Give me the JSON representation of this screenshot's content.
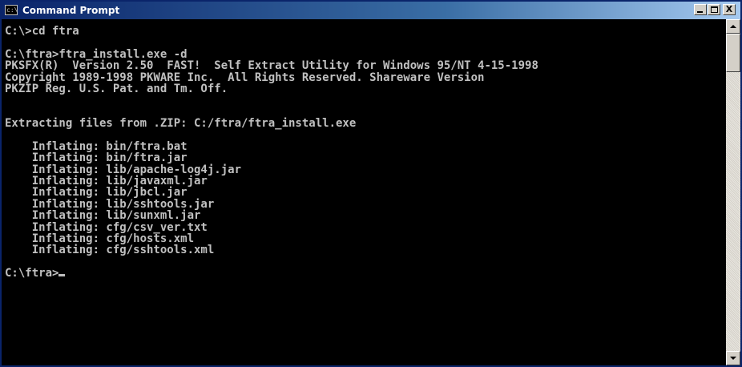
{
  "window": {
    "title": "Command Prompt",
    "icon_label": "c:\\",
    "icon": "console-icon",
    "buttons": {
      "minimize": "minimize-icon",
      "maximize": "maximize-icon",
      "close_label": "X"
    }
  },
  "colors": {
    "titlebar_start": "#0a246a",
    "titlebar_end": "#a6caf0",
    "console_background": "#000000",
    "console_text": "#c0c0c0",
    "window_chrome": "#d4d0c8"
  },
  "console": {
    "lines": [
      "C:\\>cd ftra",
      "",
      "C:\\ftra>ftra_install.exe -d",
      "PKSFX(R)  Version 2.50  FAST!  Self Extract Utility for Windows 95/NT 4-15-1998",
      "Copyright 1989-1998 PKWARE Inc.  All Rights Reserved. Shareware Version",
      "PKZIP Reg. U.S. Pat. and Tm. Off.",
      "",
      "",
      "Extracting files from .ZIP: C:/ftra/ftra_install.exe",
      "",
      "    Inflating: bin/ftra.bat",
      "    Inflating: bin/ftra.jar",
      "    Inflating: lib/apache-log4j.jar",
      "    Inflating: lib/javaxml.jar",
      "    Inflating: lib/jbcl.jar",
      "    Inflating: lib/sshtools.jar",
      "    Inflating: lib/sunxml.jar",
      "    Inflating: cfg/csv_ver.txt",
      "    Inflating: cfg/hosts.xml",
      "    Inflating: cfg/sshtools.xml",
      "",
      "C:\\ftra>"
    ]
  },
  "scrollbar": {
    "up_icon": "scroll-up-arrow-icon",
    "down_icon": "scroll-down-arrow-icon"
  }
}
